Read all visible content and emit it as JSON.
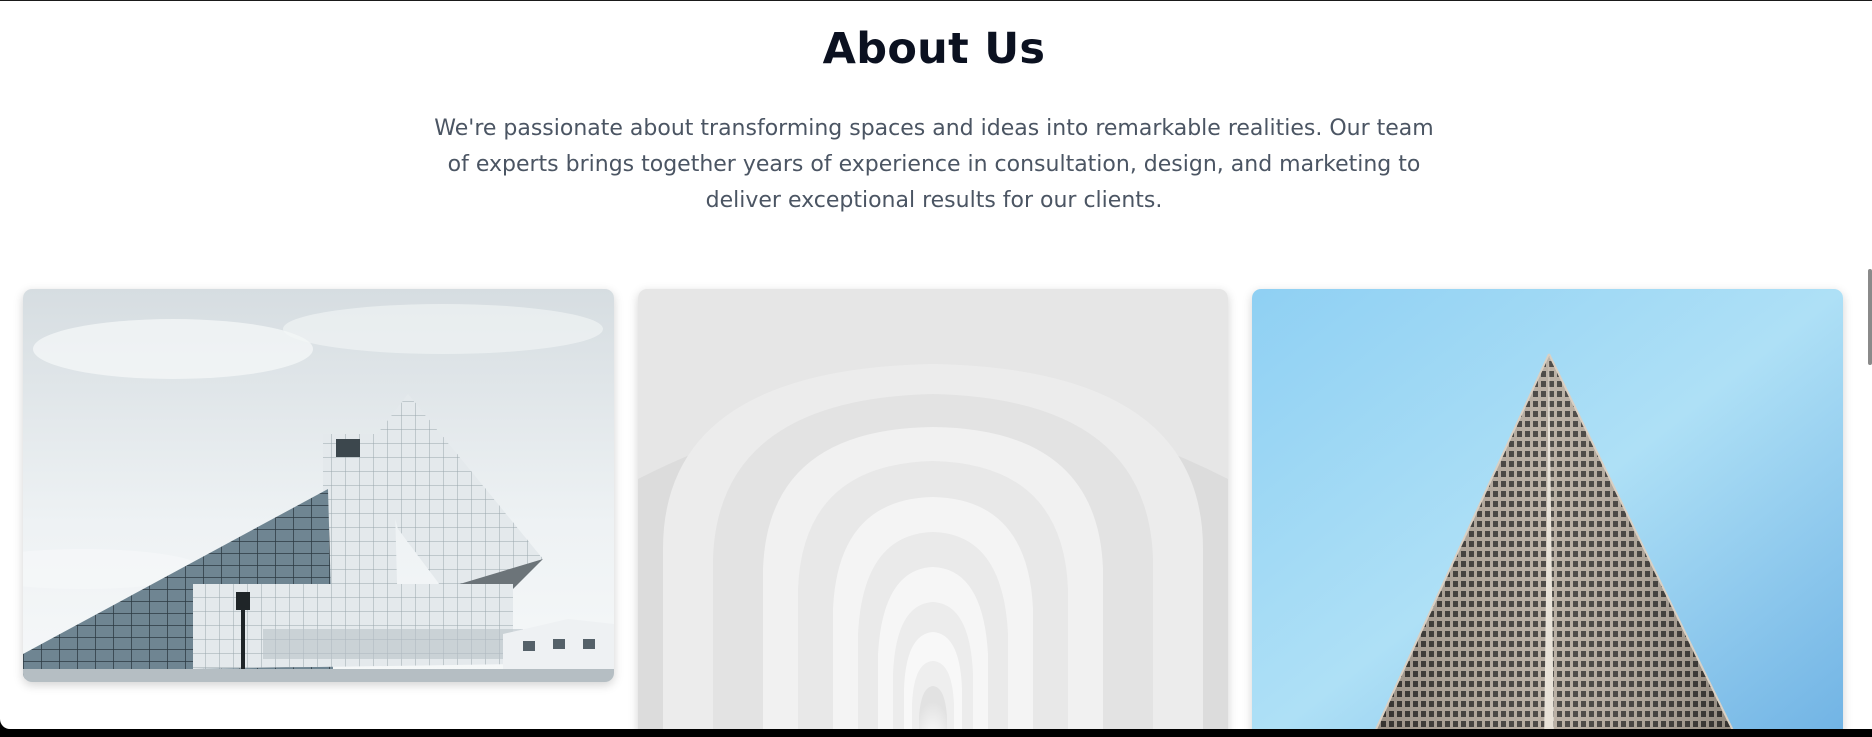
{
  "about": {
    "title": "About Us",
    "description": "We're passionate about transforming spaces and ideas into remarkable realities. Our team of experts brings together years of experience in consultation, design, and marketing to deliver exceptional results for our clients."
  },
  "gallery": {
    "cards": [
      {
        "subject": "angular-glass-building",
        "sky_color": "#dfe6ea"
      },
      {
        "subject": "white-nested-arches",
        "wall_color": "#e9e9e9"
      },
      {
        "subject": "skyscraper-from-below",
        "sky_color": "#8fcdf0"
      }
    ]
  }
}
